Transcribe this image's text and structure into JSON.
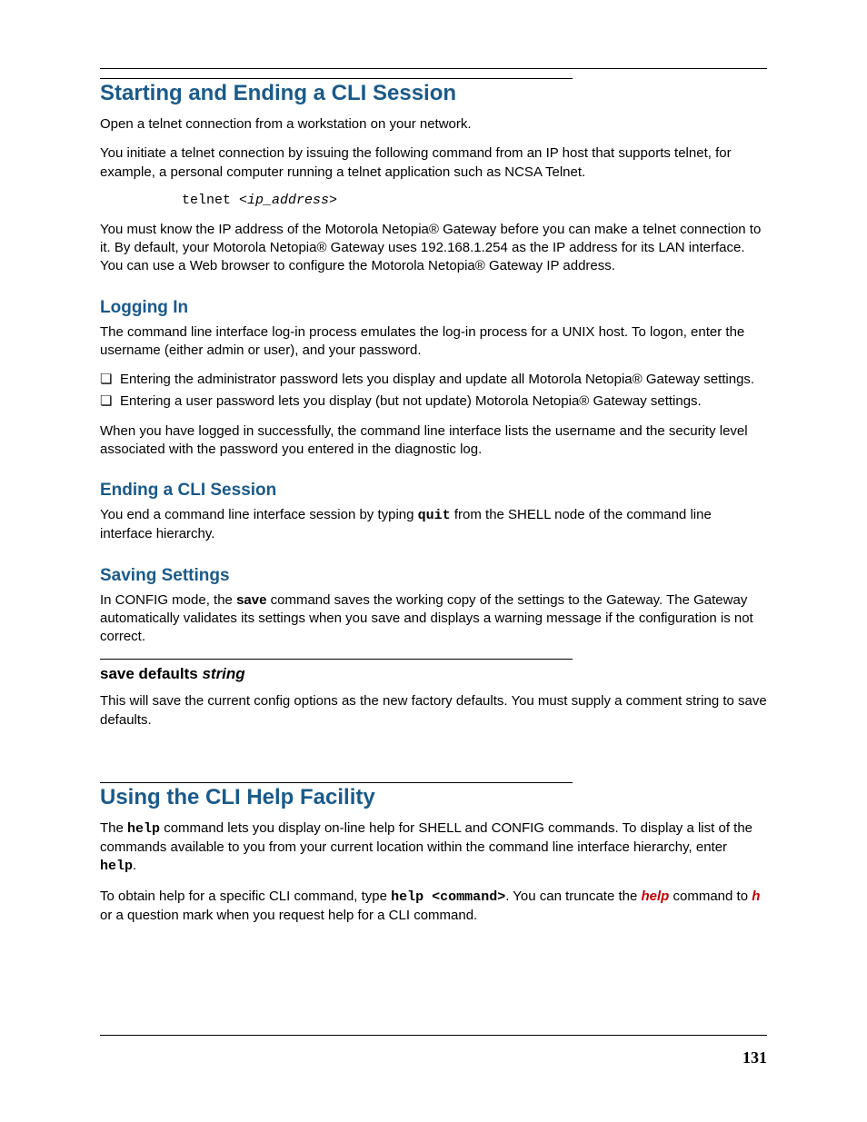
{
  "page_number": "131",
  "section1": {
    "title": "Starting and Ending a CLI Session",
    "p1": "Open a telnet connection from a workstation on your network.",
    "p2": "You initiate a telnet connection by issuing the following command from an IP host that supports telnet, for example, a personal computer running a telnet application such as NCSA Telnet.",
    "code_cmd": "telnet <",
    "code_arg": "ip_address",
    "code_close": ">",
    "p3": "You must know the IP address of the Motorola Netopia® Gateway before you can make a telnet connection to it. By default, your Motorola Netopia® Gateway uses 192.168.1.254 as the IP address for its LAN interface. You can use a Web browser to configure the Motorola Netopia® Gateway IP address."
  },
  "logging_in": {
    "title": "Logging In",
    "p1": "The command line interface log-in process emulates the log-in process for a UNIX host. To logon, enter the username (either admin or user), and your password.",
    "bullets": [
      "Entering the administrator password lets you display and update all Motorola Netopia® Gateway settings.",
      "Entering a user password lets you display (but not update) Motorola Netopia® Gateway settings."
    ],
    "p2": "When you have logged in successfully, the command line interface lists the username and the security level associated with the password you entered in the diagnostic log."
  },
  "ending": {
    "title": "Ending a CLI Session",
    "p1a": "You end a command line interface session by typing ",
    "p1_cmd": "quit",
    "p1b": " from the SHELL node of the command line interface hierarchy."
  },
  "saving": {
    "title": "Saving Settings",
    "p1a": "In CONFIG mode, the ",
    "p1_cmd": "save",
    "p1b": " command saves the working copy of the settings to the Gateway. The Gateway automatically validates its settings when you save and displays a warning message if the configuration is not correct."
  },
  "save_defaults": {
    "title_a": "save defaults ",
    "title_b": "string",
    "p1": "This will save the current config options as the new factory defaults. You must supply a comment string to save defaults."
  },
  "help": {
    "title": "Using the CLI Help Facility",
    "p1a": "The ",
    "p1_cmd1": "help",
    "p1b": " command lets you display on-line help for SHELL and CONFIG commands. To display a list of the commands available to you from your current location within the command line interface hierarchy, enter ",
    "p1_cmd2": "help",
    "p1c": ".",
    "p2a": "To obtain help for a specific CLI command, type ",
    "p2_cmd": "help <command>",
    "p2b": ". You can truncate the ",
    "p2_red1": "help",
    "p2c": " command to ",
    "p2_red2": "h",
    "p2d": " or a question mark when you request help for a CLI command."
  }
}
